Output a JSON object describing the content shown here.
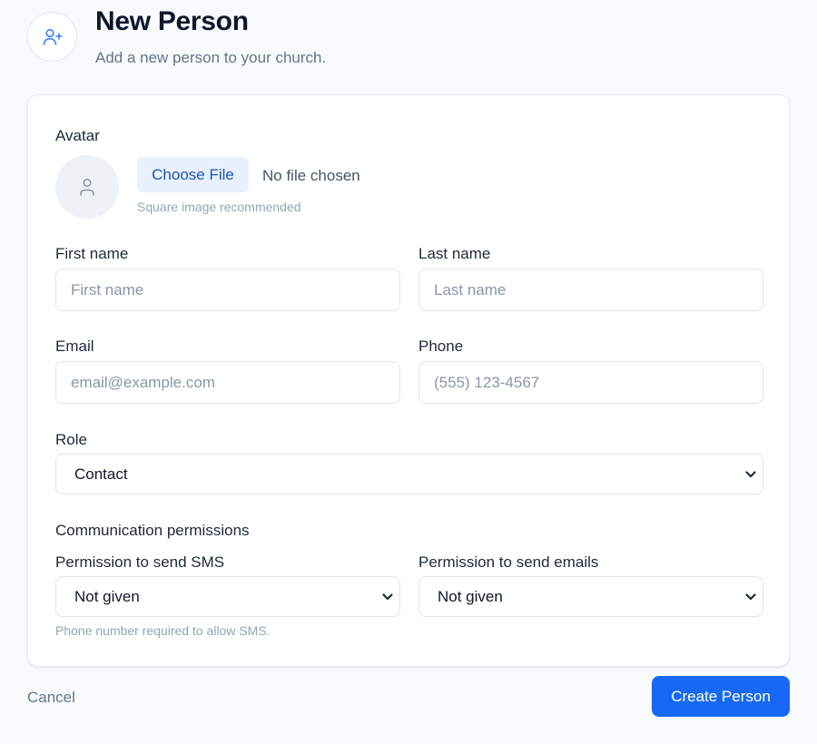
{
  "header": {
    "icon": "user-plus-icon",
    "title": "New Person",
    "subtitle": "Add a new person to your church."
  },
  "form": {
    "avatar": {
      "label": "Avatar",
      "placeholder_icon": "user-icon",
      "choose_file_label": "Choose File",
      "file_status": "No file chosen",
      "hint": "Square image recommended"
    },
    "first_name": {
      "label": "First name",
      "placeholder": "First name",
      "value": ""
    },
    "last_name": {
      "label": "Last name",
      "placeholder": "Last name",
      "value": ""
    },
    "email": {
      "label": "Email",
      "placeholder": "email@example.com",
      "value": ""
    },
    "phone": {
      "label": "Phone",
      "placeholder": "(555) 123-4567",
      "value": ""
    },
    "role": {
      "label": "Role",
      "selected": "Contact",
      "icon": "chevron-down-icon"
    },
    "communication": {
      "section_label": "Communication permissions",
      "sms": {
        "label": "Permission to send SMS",
        "selected": "Not given"
      },
      "email": {
        "label": "Permission to send emails",
        "selected": "Not given"
      },
      "sms_hint": "Phone number required to allow SMS."
    }
  },
  "actions": {
    "cancel_label": "Cancel",
    "create_label": "Create Person"
  },
  "colors": {
    "accent": "#1769f5",
    "file_button_bg": "#e8f1fd",
    "file_button_text": "#1e55b8",
    "page_bg": "#f8fafc",
    "card_bg": "#ffffff"
  }
}
